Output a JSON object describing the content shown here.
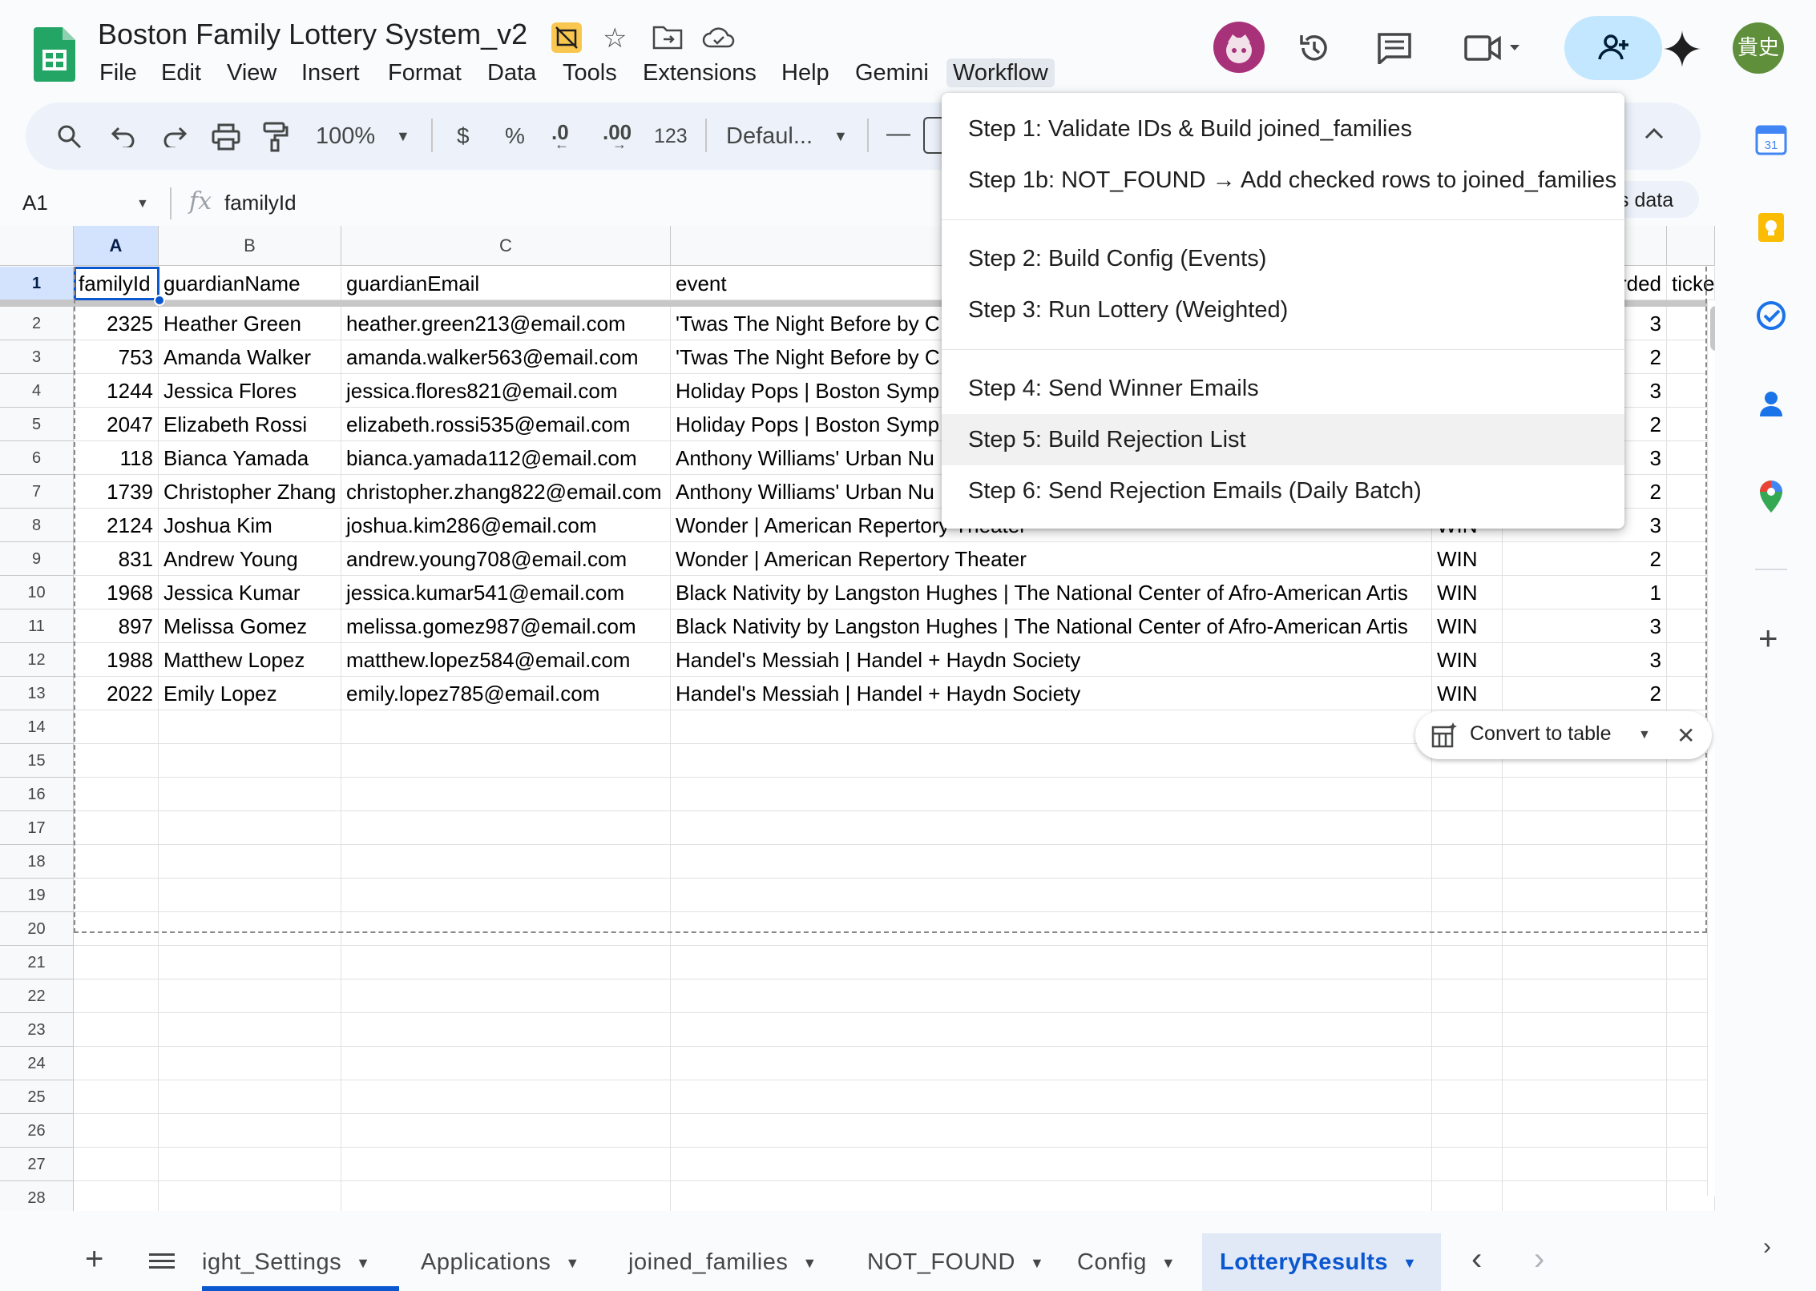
{
  "doc": {
    "title": "Boston Family Lottery System_v2",
    "menus": [
      "File",
      "Edit",
      "View",
      "Insert",
      "Format",
      "Data",
      "Tools",
      "Extensions",
      "Help",
      "Gemini",
      "Workflow"
    ],
    "avatar_initials": "貴史"
  },
  "toolbar": {
    "zoom": "100%",
    "currency": "$",
    "percent": "%",
    "dec_decrease": ".0",
    "dec_increase": ".00",
    "number_format": "123",
    "font": "Defaul...",
    "font_size_minus": "—"
  },
  "formula_bar": {
    "name_box": "A1",
    "fx": "fx",
    "content": "familyId",
    "right_chip": "s data"
  },
  "columns": [
    "A",
    "B",
    "C"
  ],
  "headers": [
    "familyId",
    "guardianName",
    "guardianEmail",
    "event",
    "rded",
    "ticke"
  ],
  "rows": [
    {
      "id": "2325",
      "name": "Heather Green",
      "email": "heather.green213@email.com",
      "event": "'Twas The Night Before by C",
      "status": "",
      "n": "3"
    },
    {
      "id": "753",
      "name": "Amanda Walker",
      "email": "amanda.walker563@email.com",
      "event": "'Twas The Night Before by C",
      "status": "",
      "n": "2"
    },
    {
      "id": "1244",
      "name": "Jessica Flores",
      "email": "jessica.flores821@email.com",
      "event": "Holiday Pops | Boston Symp",
      "status": "",
      "n": "3"
    },
    {
      "id": "2047",
      "name": "Elizabeth Rossi",
      "email": "elizabeth.rossi535@email.com",
      "event": "Holiday Pops | Boston Symp",
      "status": "",
      "n": "2"
    },
    {
      "id": "118",
      "name": "Bianca Yamada",
      "email": "bianca.yamada112@email.com",
      "event": "Anthony Williams' Urban Nu",
      "status": "",
      "n": "3"
    },
    {
      "id": "1739",
      "name": "Christopher Zhang",
      "email": "christopher.zhang822@email.com",
      "event": "Anthony Williams' Urban Nu",
      "status": "",
      "n": "2"
    },
    {
      "id": "2124",
      "name": "Joshua Kim",
      "email": "joshua.kim286@email.com",
      "event": "Wonder | American Repertory Theater",
      "status": "WIN",
      "n": "3"
    },
    {
      "id": "831",
      "name": "Andrew Young",
      "email": "andrew.young708@email.com",
      "event": "Wonder | American Repertory Theater",
      "status": "WIN",
      "n": "2"
    },
    {
      "id": "1968",
      "name": "Jessica Kumar",
      "email": "jessica.kumar541@email.com",
      "event": "Black Nativity by Langston Hughes | The National Center of Afro-American Artis",
      "status": "WIN",
      "n": "1"
    },
    {
      "id": "897",
      "name": "Melissa Gomez",
      "email": "melissa.gomez987@email.com",
      "event": "Black Nativity by Langston Hughes | The National Center of Afro-American Artis",
      "status": "WIN",
      "n": "3"
    },
    {
      "id": "1988",
      "name": "Matthew Lopez",
      "email": "matthew.lopez584@email.com",
      "event": "Handel's Messiah | Handel + Haydn Society",
      "status": "WIN",
      "n": "3"
    },
    {
      "id": "2022",
      "name": "Emily Lopez",
      "email": "emily.lopez785@email.com",
      "event": "Handel's Messiah | Handel + Haydn Society",
      "status": "WIN",
      "n": "2"
    }
  ],
  "row_numbers": [
    "1",
    "2",
    "3",
    "4",
    "5",
    "6",
    "7",
    "8",
    "9",
    "10",
    "11",
    "12",
    "13",
    "14",
    "15",
    "16",
    "17",
    "18",
    "19",
    "20",
    "21",
    "22",
    "23",
    "24",
    "25",
    "26",
    "27",
    "28"
  ],
  "workflow_menu": [
    "Step 1: Validate IDs & Build joined_families",
    "Step 1b: NOT_FOUND → Add checked rows to joined_families",
    "Step 2: Build Config (Events)",
    "Step 3: Run Lottery (Weighted)",
    "Step 4: Send Winner Emails",
    "Step 5: Build Rejection List",
    "Step 6: Send Rejection Emails (Daily Batch)"
  ],
  "convert_chip": {
    "label": "Convert to table"
  },
  "sheet_tabs": [
    "ight_Settings",
    "Applications",
    "joined_families",
    "NOT_FOUND",
    "Config",
    "LotteryResults"
  ],
  "colors": {
    "accent": "#0b57d0",
    "active_tab_bg": "#e1e9f7",
    "sheets_green": "#0f9d58",
    "avatar_green": "#5f8f3a"
  }
}
